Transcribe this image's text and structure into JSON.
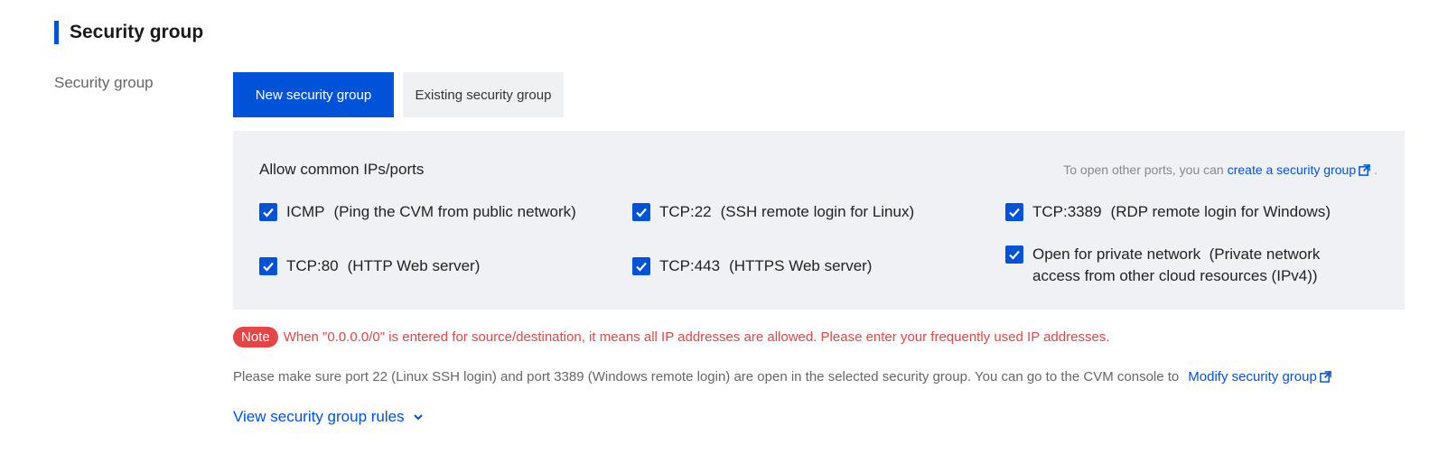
{
  "section": {
    "title": "Security group"
  },
  "field": {
    "label": "Security group"
  },
  "tabs": [
    {
      "label": "New security group",
      "active": true
    },
    {
      "label": "Existing security group",
      "active": false
    }
  ],
  "panel": {
    "heading": "Allow common IPs/ports",
    "hint_prefix": "To open other ports, you can ",
    "hint_link": "create a security group",
    "hint_suffix": ".",
    "items": [
      {
        "name": "ICMP",
        "desc": "(Ping the CVM from public network)",
        "checked": true
      },
      {
        "name": "TCP:22",
        "desc": "(SSH remote login for Linux)",
        "checked": true
      },
      {
        "name": "TCP:3389",
        "desc": "(RDP remote login for Windows)",
        "checked": true
      },
      {
        "name": "TCP:80",
        "desc": "(HTTP Web server)",
        "checked": true
      },
      {
        "name": "TCP:443",
        "desc": "(HTTPS Web server)",
        "checked": true
      },
      {
        "name": "Open for private network",
        "desc": "(Private network access from other cloud resources (IPv4))",
        "checked": true
      }
    ]
  },
  "note": {
    "badge": "Note",
    "text": "When \"0.0.0.0/0\" is entered for source/destination, it means all IP addresses are allowed. Please enter your frequently used IP addresses."
  },
  "help": {
    "text": "Please make sure port 22 (Linux SSH login) and port 3389 (Windows remote login) are open in the selected security group. You can go to the CVM console to",
    "link": "Modify security group"
  },
  "view_rules": {
    "label": "View security group rules"
  },
  "colors": {
    "accent": "#0052d9",
    "danger": "#e54545",
    "panel_bg": "#f0f1f4"
  },
  "icons": {
    "checkbox": "check-icon",
    "external": "external-link-icon",
    "expand": "chevron-down-icon"
  }
}
